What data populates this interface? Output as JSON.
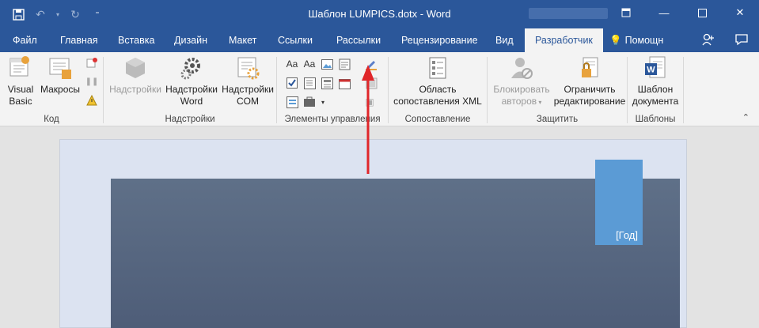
{
  "window": {
    "title": "Шаблон LUMPICS.dotx - Word"
  },
  "tabs": [
    {
      "label": "Файл"
    },
    {
      "label": "Главная"
    },
    {
      "label": "Вставка"
    },
    {
      "label": "Дизайн"
    },
    {
      "label": "Макет"
    },
    {
      "label": "Ссылки"
    },
    {
      "label": "Рассылки"
    },
    {
      "label": "Рецензирование"
    },
    {
      "label": "Вид"
    },
    {
      "label": "Разработчик"
    },
    {
      "label": "Помощн"
    }
  ],
  "active_tab": "Разработчик",
  "ribbon": {
    "code": {
      "label": "Код",
      "visual_basic": "Visual Basic",
      "macros": "Макросы"
    },
    "addins": {
      "label": "Надстройки",
      "addins_btn": "Надстройки",
      "word_addins": "Надстройки Word",
      "com_addins": "Надстройки COM"
    },
    "controls": {
      "label": "Элементы управления"
    },
    "mapping": {
      "label": "Сопоставление",
      "xml_pane": "Область сопоставления XML"
    },
    "protect": {
      "label": "Защитить",
      "block_authors": "Блокировать авторов",
      "restrict_editing": "Ограничить редактирование"
    },
    "templates": {
      "label": "Шаблоны",
      "document_template": "Шаблон документа"
    }
  },
  "document": {
    "year_placeholder": "[Год]"
  },
  "colors": {
    "accent": "#2b579a",
    "ribbon_bg": "#f3f3f3",
    "cover_dark": "#56667f",
    "cover_year": "#5b9bd5",
    "annotation_arrow": "#e0262a"
  }
}
